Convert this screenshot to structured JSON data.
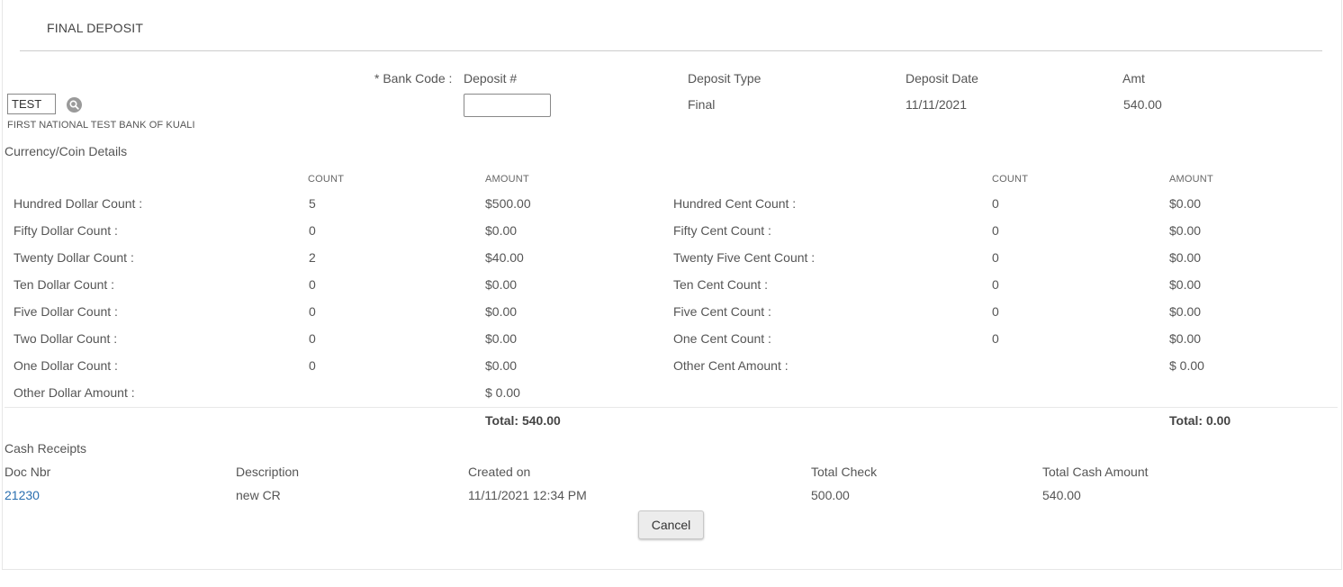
{
  "page": {
    "title": "FINAL DEPOSIT"
  },
  "deposit_header": {
    "bank_code_label": "* Bank Code :",
    "deposit_num_label": "Deposit #",
    "deposit_type_label": "Deposit Type",
    "deposit_date_label": "Deposit Date",
    "amt_label": "Amt",
    "bank_code_value": "TEST",
    "bank_name": "FIRST NATIONAL TEST BANK OF KUALI",
    "deposit_num_value": "",
    "deposit_type_value": "Final",
    "deposit_date_value": "11/11/2021",
    "amt_value": "540.00"
  },
  "currency": {
    "section_title": "Currency/Coin Details",
    "count_header": "COUNT",
    "amount_header": "AMOUNT",
    "dollar_rows": [
      {
        "label": "Hundred Dollar Count :",
        "count": "5",
        "amount": "$500.00"
      },
      {
        "label": "Fifty Dollar Count :",
        "count": "0",
        "amount": "$0.00"
      },
      {
        "label": "Twenty Dollar Count :",
        "count": "2",
        "amount": "$40.00"
      },
      {
        "label": "Ten Dollar Count :",
        "count": "0",
        "amount": "$0.00"
      },
      {
        "label": "Five Dollar Count :",
        "count": "0",
        "amount": "$0.00"
      },
      {
        "label": "Two Dollar Count :",
        "count": "0",
        "amount": "$0.00"
      },
      {
        "label": "One Dollar Count :",
        "count": "0",
        "amount": "$0.00"
      },
      {
        "label": "Other Dollar Amount :",
        "count": "",
        "amount": "$ 0.00"
      }
    ],
    "cent_rows": [
      {
        "label": "Hundred Cent Count :",
        "count": "0",
        "amount": "$0.00"
      },
      {
        "label": "Fifty Cent Count :",
        "count": "0",
        "amount": "$0.00"
      },
      {
        "label": "Twenty Five Cent Count :",
        "count": "0",
        "amount": "$0.00"
      },
      {
        "label": "Ten Cent Count :",
        "count": "0",
        "amount": "$0.00"
      },
      {
        "label": "Five Cent Count :",
        "count": "0",
        "amount": "$0.00"
      },
      {
        "label": "One Cent Count :",
        "count": "0",
        "amount": "$0.00"
      },
      {
        "label": "Other Cent Amount :",
        "count": "",
        "amount": "$ 0.00"
      }
    ],
    "dollar_total": "Total: 540.00",
    "cent_total": "Total: 0.00"
  },
  "cash_receipts": {
    "section_title": "Cash Receipts",
    "headers": [
      "Doc Nbr",
      "Description",
      "Created on",
      "Total Check",
      "Total Cash Amount"
    ],
    "rows": [
      {
        "doc_nbr": "21230",
        "description": "new CR",
        "created_on": "11/11/2021 12:34 PM",
        "total_check": "500.00",
        "total_cash": "540.00"
      }
    ]
  },
  "actions": {
    "cancel_label": "Cancel"
  },
  "colors": {
    "link": "#2a6fb0",
    "button_bg": "#ececec"
  }
}
